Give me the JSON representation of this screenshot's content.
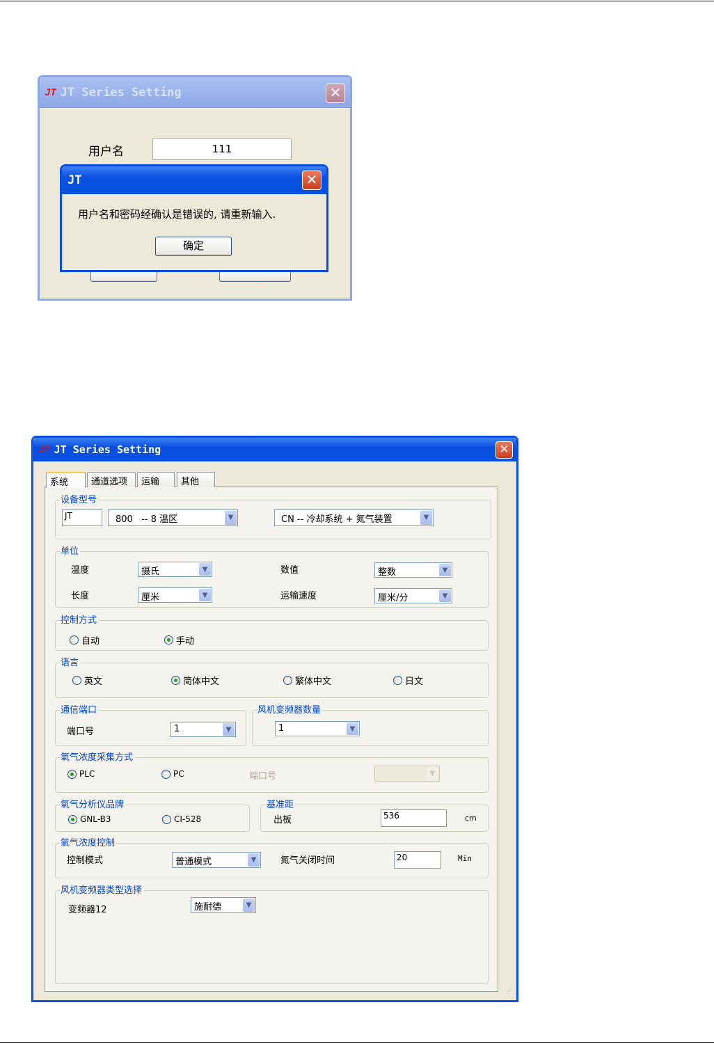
{
  "login_dialog": {
    "title": "JT Series Setting",
    "logo": "JT",
    "username_label": "用户名",
    "username_value": "111",
    "message_box": {
      "title": "JT",
      "message": "用户名和密码经确认是错误的, 请重新输入.",
      "ok_label": "确定"
    }
  },
  "settings_dialog": {
    "title": "JT Series Setting",
    "logo": "JT",
    "tabs": [
      "系统",
      "通道选项",
      "运输",
      "其他"
    ],
    "device_model": {
      "legend": "设备型号",
      "prefix": "JT",
      "model": "800   -- 8 温区",
      "config": "CN -- 冷却系统 + 氮气装置"
    },
    "units": {
      "legend": "单位",
      "temp_label": "温度",
      "temp_value": "摄氏",
      "length_label": "长度",
      "length_value": "厘米",
      "number_label": "数值",
      "number_value": "整数",
      "speed_label": "运输速度",
      "speed_value": "厘米/分"
    },
    "control": {
      "legend": "控制方式",
      "options": [
        "自动",
        "手动"
      ],
      "selected": "手动"
    },
    "language": {
      "legend": "语言",
      "options": [
        "英文",
        "简体中文",
        "繁体中文",
        "日文"
      ],
      "selected": "简体中文"
    },
    "comm_port": {
      "legend": "通信端口",
      "port_label": "端口号",
      "port_value": "1"
    },
    "fan_count": {
      "legend": "风机变频器数量",
      "value": "1"
    },
    "oxygen_collect": {
      "legend": "氧气浓度采集方式",
      "options": [
        "PLC",
        "PC"
      ],
      "selected": "PLC",
      "port_label": "端口号",
      "port_value": ""
    },
    "oxygen_brand": {
      "legend": "氧气分析仪品牌",
      "options": [
        "GNL-B3",
        "CI-528"
      ],
      "selected": "GNL-B3"
    },
    "reference": {
      "legend": "基准距",
      "label": "出板",
      "value": "536",
      "unit": "cm"
    },
    "oxygen_control": {
      "legend": "氧气浓度控制",
      "mode_label": "控制模式",
      "mode_value": "普通模式",
      "off_label": "氮气关闭时间",
      "off_value": "20",
      "off_unit": "Min"
    },
    "inverter_type": {
      "legend": "风机变频器类型选择",
      "label": "变频器12",
      "value": "施耐德"
    }
  }
}
